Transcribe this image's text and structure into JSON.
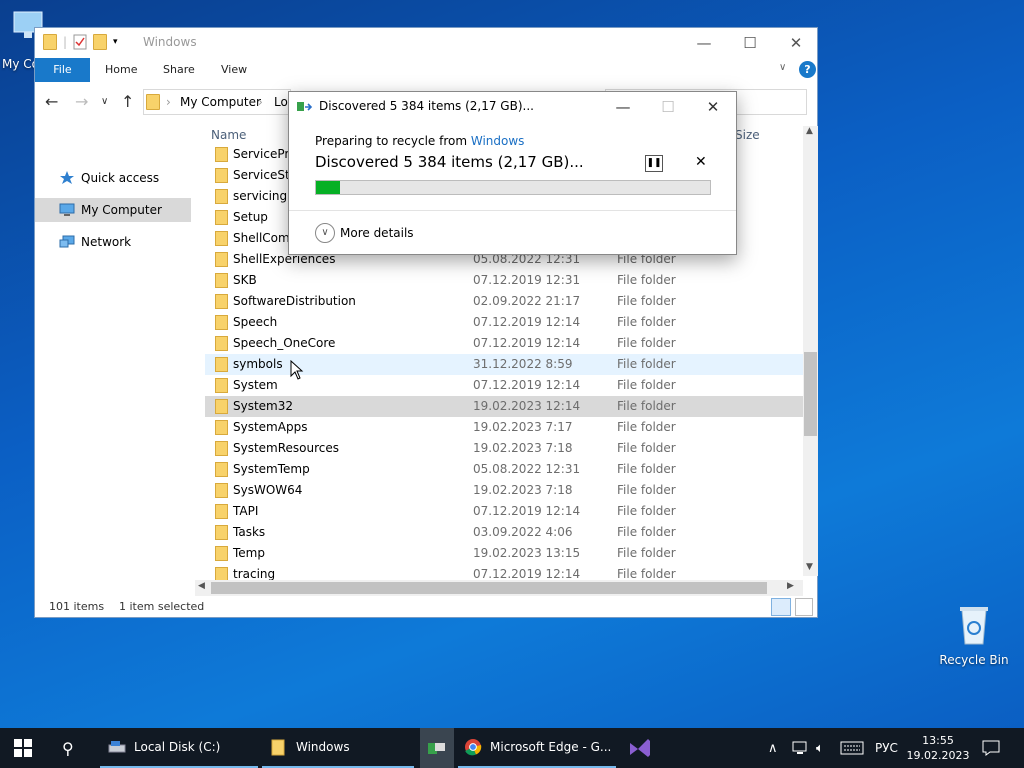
{
  "desktop": {
    "my_computer_label": "My Co",
    "recycle_bin_label": "Recycle Bin"
  },
  "explorer": {
    "title": "Windows",
    "ribbon_tabs": [
      "File",
      "Home",
      "Share",
      "View"
    ],
    "breadcrumb": [
      "My Computer",
      "Lo"
    ],
    "nav": {
      "quick_access": "Quick access",
      "my_computer": "My Computer",
      "network": "Network"
    },
    "columns": {
      "name": "Name",
      "size": "Size"
    },
    "rows": [
      {
        "name": "ServiceProf",
        "date": "",
        "type": ""
      },
      {
        "name": "ServiceStat",
        "date": "",
        "type": ""
      },
      {
        "name": "servicing",
        "date": "",
        "type": ""
      },
      {
        "name": "Setup",
        "date": "",
        "type": ""
      },
      {
        "name": "ShellComp",
        "date": "",
        "type": ""
      },
      {
        "name": "ShellExperiences",
        "date": "05.08.2022 12:31",
        "type": "File folder"
      },
      {
        "name": "SKB",
        "date": "07.12.2019 12:31",
        "type": "File folder"
      },
      {
        "name": "SoftwareDistribution",
        "date": "02.09.2022 21:17",
        "type": "File folder"
      },
      {
        "name": "Speech",
        "date": "07.12.2019 12:14",
        "type": "File folder"
      },
      {
        "name": "Speech_OneCore",
        "date": "07.12.2019 12:14",
        "type": "File folder"
      },
      {
        "name": "symbols",
        "date": "31.12.2022 8:59",
        "type": "File folder"
      },
      {
        "name": "System",
        "date": "07.12.2019 12:14",
        "type": "File folder"
      },
      {
        "name": "System32",
        "date": "19.02.2023 12:14",
        "type": "File folder"
      },
      {
        "name": "SystemApps",
        "date": "19.02.2023 7:17",
        "type": "File folder"
      },
      {
        "name": "SystemResources",
        "date": "19.02.2023 7:18",
        "type": "File folder"
      },
      {
        "name": "SystemTemp",
        "date": "05.08.2022 12:31",
        "type": "File folder"
      },
      {
        "name": "SysWOW64",
        "date": "19.02.2023 7:18",
        "type": "File folder"
      },
      {
        "name": "TAPI",
        "date": "07.12.2019 12:14",
        "type": "File folder"
      },
      {
        "name": "Tasks",
        "date": "03.09.2022 4:06",
        "type": "File folder"
      },
      {
        "name": "Temp",
        "date": "19.02.2023 13:15",
        "type": "File folder"
      },
      {
        "name": "tracing",
        "date": "07.12.2019 12:14",
        "type": "File folder"
      }
    ],
    "status": {
      "count": "101 items",
      "selected": "1 item selected"
    }
  },
  "dialog": {
    "title": "Discovered 5 384 items (2,17 GB)...",
    "preparing_prefix": "Preparing to recycle from",
    "source_link": "Windows",
    "headline": "Discovered 5 384 items (2,17 GB)...",
    "progress": 0.06,
    "more_details": "More details"
  },
  "taskbar": {
    "items": [
      "Local Disk (C:)",
      "Windows",
      "Microsoft Edge - G..."
    ],
    "lang": "РУС",
    "time": "13:55",
    "date": "19.02.2023"
  },
  "colors": {
    "accent": "#1979ca",
    "progress": "#06b025",
    "taskbar": "#111923"
  }
}
